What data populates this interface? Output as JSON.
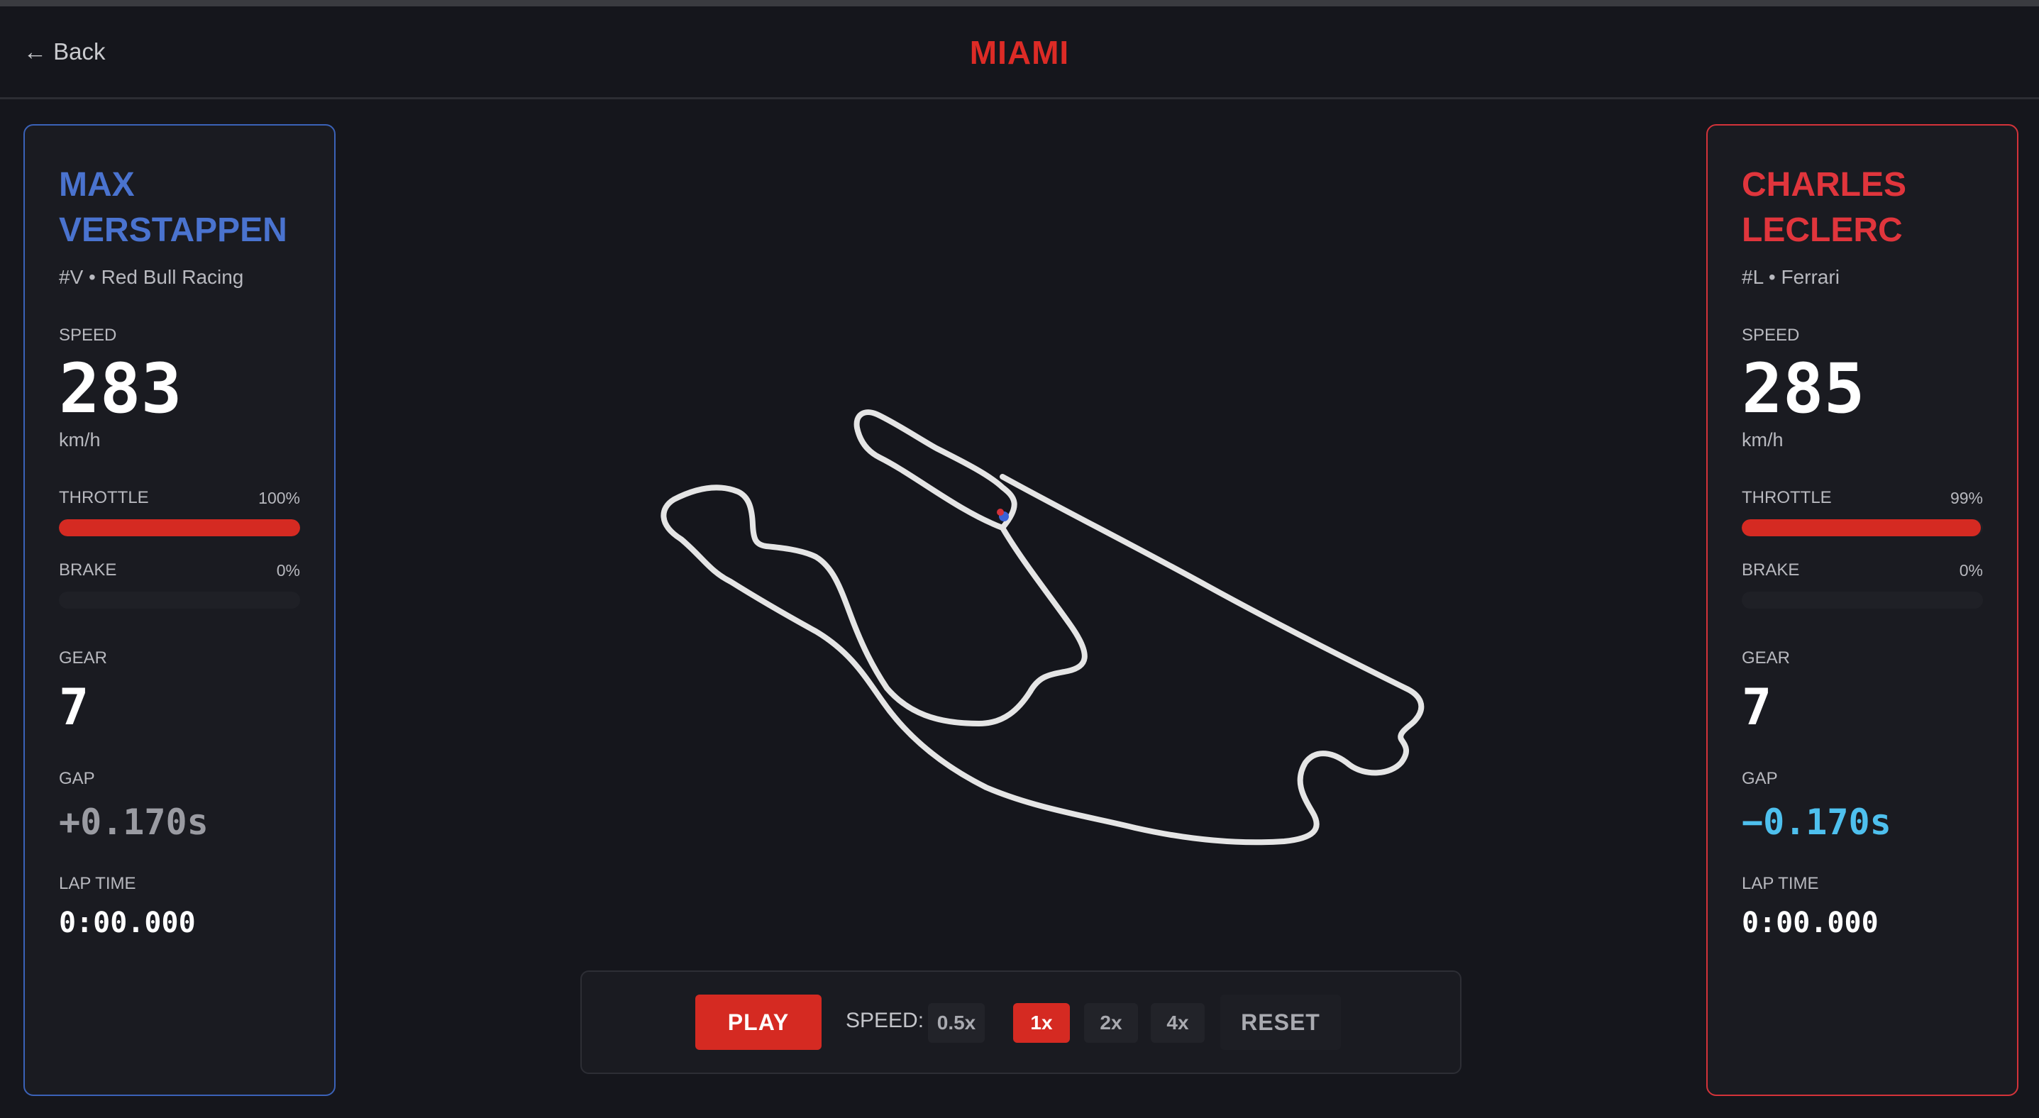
{
  "header": {
    "back_label": "← Back",
    "title": "MIAMI"
  },
  "drivers": [
    {
      "name_line1": "MAX",
      "name_line2": "VERSTAPPEN",
      "team_line": "#V • Red Bull Racing",
      "color": "#4a73cf",
      "speed_label": "SPEED",
      "speed": "283",
      "speed_unit": "km/h",
      "throttle_label": "THROTTLE",
      "throttle_pct": "100%",
      "throttle_value": 1.0,
      "brake_label": "BRAKE",
      "brake_pct": "0%",
      "brake_value": 0.0,
      "gear_label": "GEAR",
      "gear": "7",
      "gap_label": "GAP",
      "gap": "+0.170s",
      "lap_label": "LAP TIME",
      "lap_time": "0:00.000"
    },
    {
      "name_line1": "CHARLES",
      "name_line2": "LECLERC",
      "team_line": "#L • Ferrari",
      "color": "#e0353c",
      "speed_label": "SPEED",
      "speed": "285",
      "speed_unit": "km/h",
      "throttle_label": "THROTTLE",
      "throttle_pct": "99%",
      "throttle_value": 0.99,
      "brake_label": "BRAKE",
      "brake_pct": "0%",
      "brake_value": 0.0,
      "gear_label": "GEAR",
      "gear": "7",
      "gap_label": "GAP",
      "gap": "−0.170s",
      "lap_label": "LAP TIME",
      "lap_time": "0:00.000"
    }
  ],
  "controls": {
    "play_label": "PLAY",
    "speed_label": "SPEED:",
    "speed_options": [
      "0.5x",
      "1x",
      "2x",
      "4x"
    ],
    "selected_speed": "1x",
    "reset_label": "RESET"
  },
  "colors": {
    "accent": "#d52a22",
    "track": "#e5e5e5",
    "background": "#15161c"
  }
}
